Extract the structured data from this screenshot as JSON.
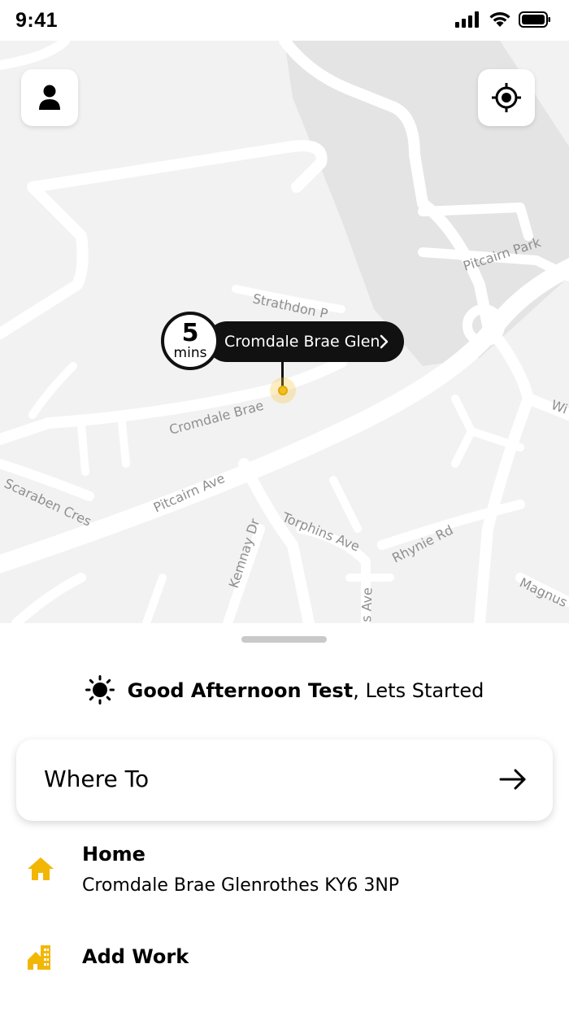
{
  "status_bar": {
    "time": "9:41"
  },
  "map": {
    "eta_value": "5",
    "eta_unit": "mins",
    "destination_label": "Cromdale Brae Glen",
    "street_labels": [
      "Strathdon P",
      "Pitcairn Park",
      "Cromdale Brae",
      "Scaraben Cres",
      "Pitcairn Ave",
      "Kemnay Dr",
      "Torphins Ave",
      "Rhynie Rd",
      "Magnus",
      "Wi",
      "s Ave"
    ]
  },
  "sheet": {
    "greeting_bold": "Good Afternoon Test",
    "greeting_rest": ", Lets Started",
    "where_to_label": "Where To",
    "home_title": "Home",
    "home_address": "Cromdale Brae Glenrothes KY6 3NP",
    "work_title": "Add Work"
  },
  "colors": {
    "accent": "#F2B705",
    "map_background": "#F2F2F2",
    "map_road": "#FFFFFF",
    "map_park": "#E4E4E4",
    "pill_background": "#111111"
  },
  "icons": {
    "profile": "person-icon",
    "locate": "crosshair-icon",
    "greeting": "sun-icon",
    "where_to": "arrow-right-icon",
    "home": "home-icon",
    "work": "building-icon"
  }
}
